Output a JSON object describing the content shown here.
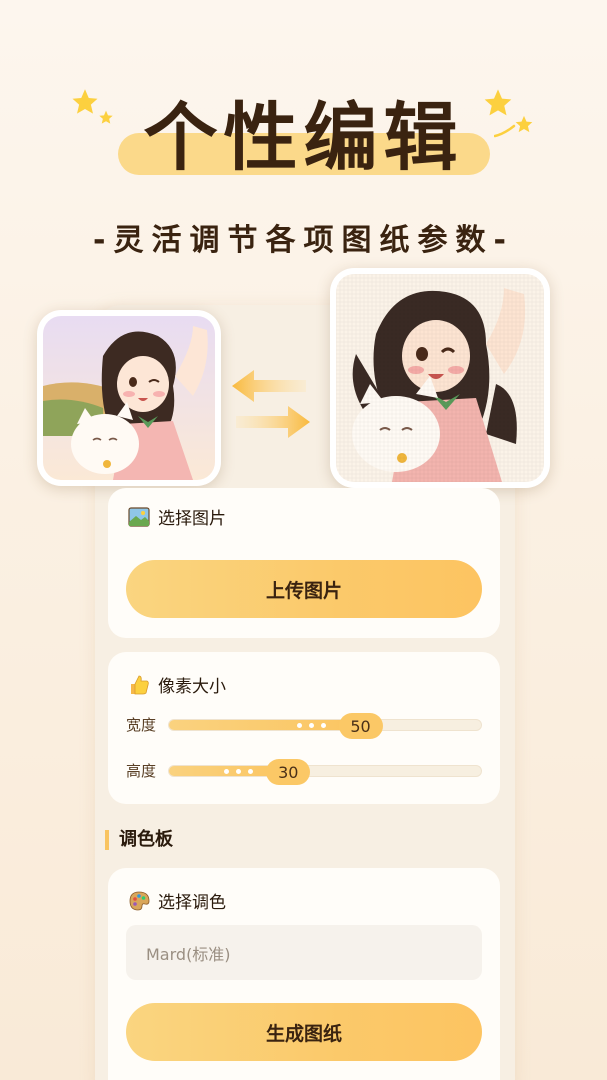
{
  "hero": {
    "title": "个性编辑",
    "subtitle": "-灵活调节各项图纸参数-"
  },
  "image_section": {
    "header": "选择图片",
    "header_icon": "picture-icon",
    "upload_button": "上传图片"
  },
  "pixel_section": {
    "header": "像素大小",
    "header_icon": "thumbs-up-icon",
    "width_label": "宽度",
    "width_value": "50",
    "width_fraction": 0.61,
    "height_label": "高度",
    "height_value": "30",
    "height_fraction": 0.38
  },
  "palette": {
    "title": "调色板",
    "header": "选择调色",
    "header_icon": "palette-icon",
    "selected_palette": "Mard(标准)",
    "generate_button": "生成图纸"
  },
  "colors": {
    "accent": "#fbc866",
    "title_text": "#3a2310",
    "highlight": "#fbd98a"
  }
}
